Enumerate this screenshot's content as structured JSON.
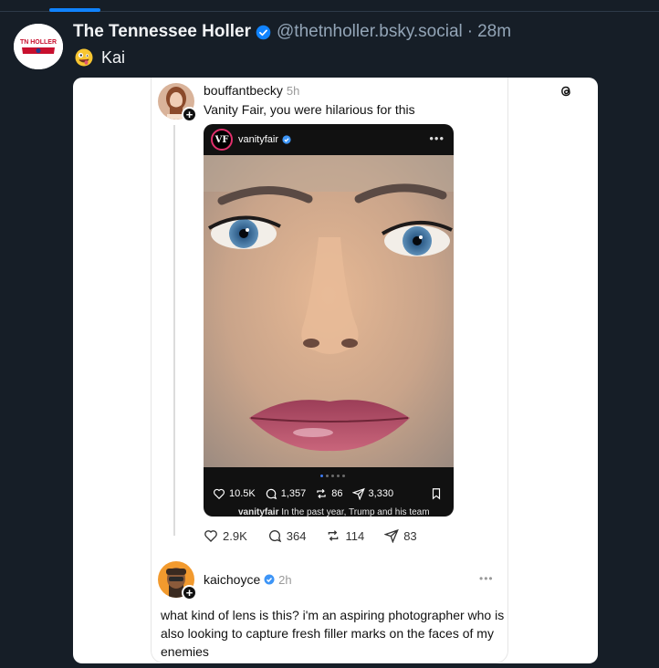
{
  "post": {
    "author_name": "The Tennessee Holler",
    "handle": "@thetnholler.bsky.social",
    "separator": "·",
    "time": "28m",
    "text": "Kai",
    "avatar_text": "TN HOLLER"
  },
  "embed": {
    "original": {
      "username": "bouffantbecky",
      "time": "5h",
      "text": "Vanity Fair, you were hilarious for this"
    },
    "instagram": {
      "logo": "VF",
      "username": "vanityfair",
      "more": "•••",
      "likes": "10.5K",
      "comments": "1,357",
      "reposts": "86",
      "shares": "3,330",
      "caption_user": "vanityfair",
      "caption": "In the past year, Trump and his team"
    },
    "post_actions": {
      "likes": "2.9K",
      "replies": "364",
      "reposts": "114",
      "shares": "83"
    },
    "reply": {
      "username": "kaichoyce",
      "time": "2h",
      "more": "•••",
      "text": "what kind of lens is this? i'm an aspiring photographer who is also looking to capture fresh filler marks on the faces of my enemies"
    }
  },
  "colors": {
    "background": "#161e27",
    "accent": "#1083fe",
    "muted": "#93a5b7"
  }
}
